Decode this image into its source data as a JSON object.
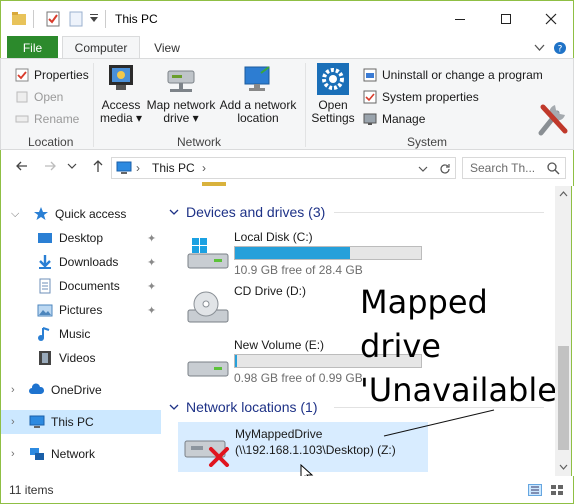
{
  "window": {
    "title": "This PC",
    "quick_access_toolbar": [
      "properties-icon",
      "new-folder-icon",
      "customize-chevron-icon"
    ]
  },
  "ribbon": {
    "tabs": [
      {
        "label": "File"
      },
      {
        "label": "Computer"
      },
      {
        "label": "View"
      }
    ],
    "location_group": {
      "label": "Location",
      "properties": "Properties",
      "open": "Open",
      "rename": "Rename"
    },
    "network_group": {
      "label": "Network",
      "access_media": "Access media",
      "map_network_drive": "Map network drive",
      "add_network_location": "Add a network location"
    },
    "system_group": {
      "label": "System",
      "open_settings": "Open Settings",
      "uninstall": "Uninstall or change a program",
      "system_properties": "System properties",
      "manage": "Manage"
    }
  },
  "address_bar": {
    "path": "This PC",
    "search_placeholder": "Search Th..."
  },
  "nav_pane": {
    "items": [
      {
        "label": "Quick access"
      },
      {
        "label": "Desktop"
      },
      {
        "label": "Downloads"
      },
      {
        "label": "Documents"
      },
      {
        "label": "Pictures"
      },
      {
        "label": "Music"
      },
      {
        "label": "Videos"
      },
      {
        "label": "OneDrive"
      },
      {
        "label": "This PC"
      },
      {
        "label": "Network"
      }
    ]
  },
  "content": {
    "devices_header": "Devices and drives (3)",
    "drives": [
      {
        "name": "Local Disk (C:)",
        "free": "10.9 GB free of 28.4 GB",
        "used_fraction": 0.616
      },
      {
        "name": "CD Drive (D:)"
      },
      {
        "name": "New Volume (E:)",
        "free": "0.98 GB free of 0.99 GB",
        "used_fraction": 0.01
      }
    ],
    "network_header": "Network locations (1)",
    "network_drive": {
      "name": "MyMappedDrive",
      "path": "(\\\\192.168.1.103\\Desktop) (Z:)"
    }
  },
  "annotation": {
    "line1": "Mapped",
    "line2": "drive",
    "line3": "'Unavailable'"
  },
  "status_bar": {
    "item_count": "11 items"
  },
  "colors": {
    "window_border": "#8fbf44",
    "file_tab": "#2c8a2c",
    "selection": "#cce8ff",
    "group_header": "#1e3287",
    "drive_bar": "#26a0da"
  }
}
